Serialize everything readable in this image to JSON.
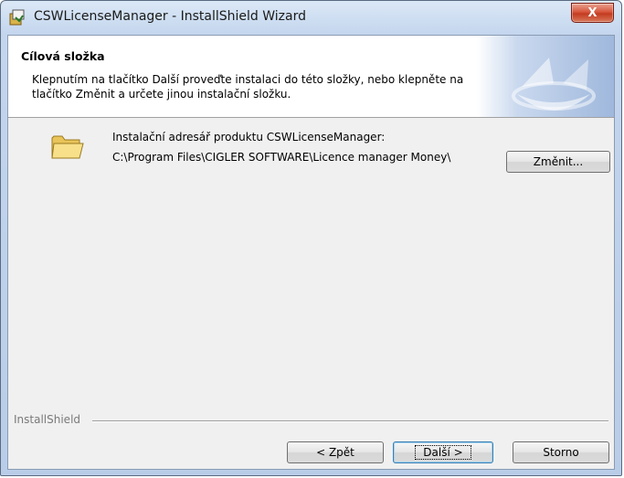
{
  "window": {
    "title": "CSWLicenseManager - InstallShield Wizard",
    "close_glyph": "X"
  },
  "banner": {
    "heading": "Cílová složka",
    "description": "Klepnutím na tlačítko Další proveďte instalaci do této složky, nebo klepněte na\ntlačítko Změnit a určete jinou instalační složku."
  },
  "destination": {
    "label": "Instalační adresář produktu CSWLicenseManager:",
    "path": "C:\\Program Files\\CIGLER SOFTWARE\\Licence manager Money\\"
  },
  "buttons": {
    "change": "Změnit...",
    "back": "< Zpět",
    "next": "Další >",
    "cancel": "Storno"
  },
  "footer": {
    "brand": "InstallShield"
  },
  "icons": {
    "app": "installer-icon",
    "folder": "folder-icon",
    "banner": "installshield-logo"
  }
}
